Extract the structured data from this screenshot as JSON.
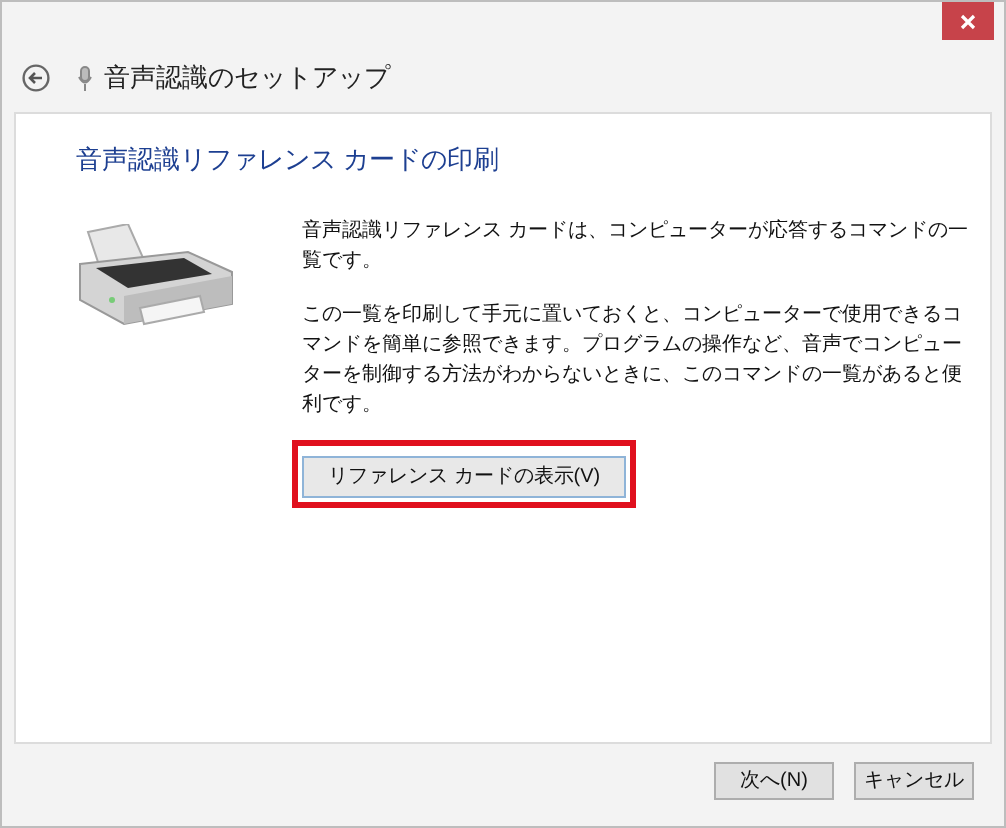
{
  "window": {
    "title": "音声認識のセットアップ"
  },
  "page": {
    "heading": "音声認識リファレンス カードの印刷",
    "paragraphs": [
      "音声認識リファレンス カードは、コンピューターが応答するコマンドの一覧です。",
      "この一覧を印刷して手元に置いておくと、コンピューターで使用できるコマンドを簡単に参照できます。プログラムの操作など、音声でコンピューターを制御する方法がわからないときに、このコマンドの一覧があると便利です。"
    ],
    "action_button": {
      "label": "リファレンス カードの表示(V)",
      "highlighted": true
    }
  },
  "footer_buttons": [
    {
      "label": "次へ(N)"
    },
    {
      "label": "キャンセル"
    }
  ]
}
